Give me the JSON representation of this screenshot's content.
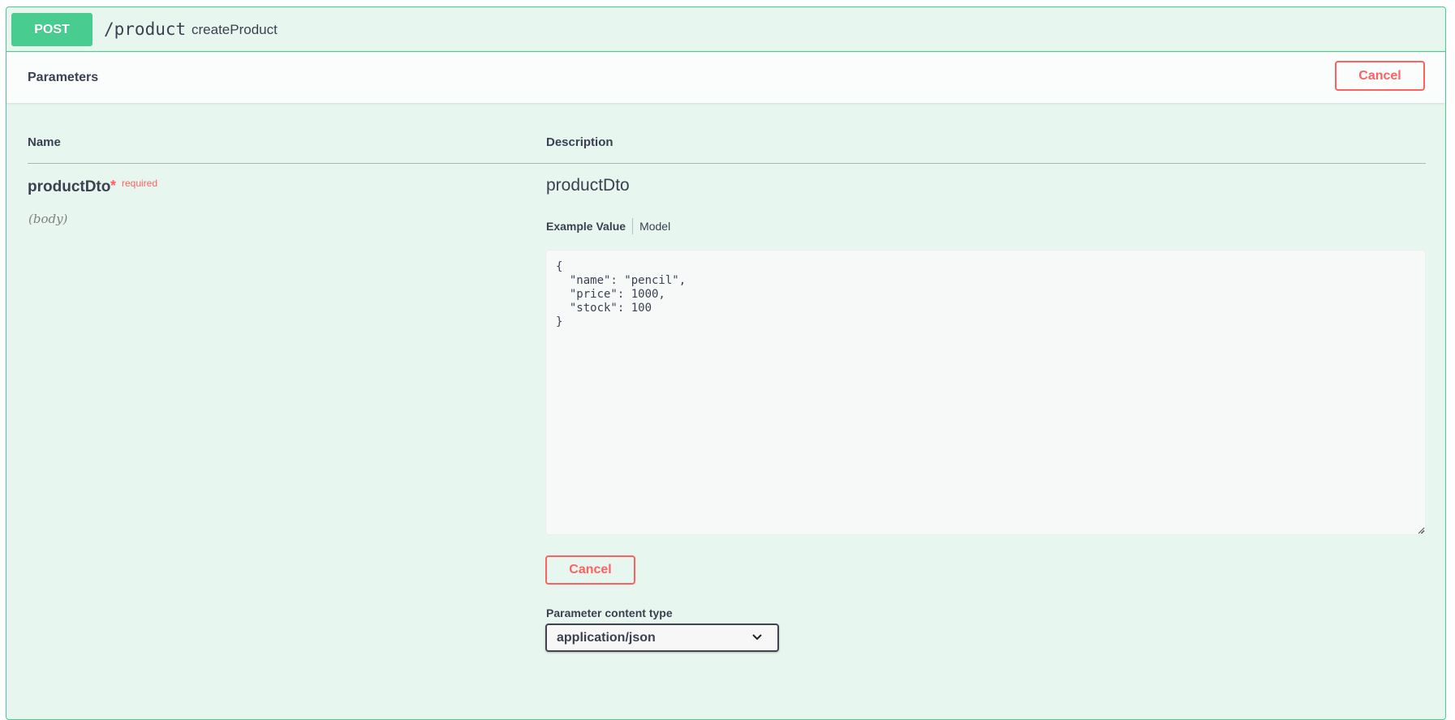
{
  "operation": {
    "method": "POST",
    "path": "/product",
    "summary": "createProduct"
  },
  "parameters_section": {
    "title": "Parameters",
    "cancel_label": "Cancel"
  },
  "table": {
    "name_header": "Name",
    "description_header": "Description"
  },
  "parameter": {
    "name": "productDto",
    "required_star": "*",
    "required_text": "required",
    "location": "(body)",
    "schema_name": "productDto",
    "tabs": [
      {
        "label": "Example Value",
        "active": true
      },
      {
        "label": "Model",
        "active": false
      }
    ],
    "body_value": "{\n  \"name\": \"pencil\",\n  \"price\": 1000,\n  \"stock\": 100\n}",
    "cancel_label": "Cancel",
    "content_type_label": "Parameter content type",
    "content_type_selected": "application/json"
  },
  "colors": {
    "post_green": "#49cc90",
    "block_bg": "#e8f6f0",
    "cancel_red": "#ff6060"
  }
}
